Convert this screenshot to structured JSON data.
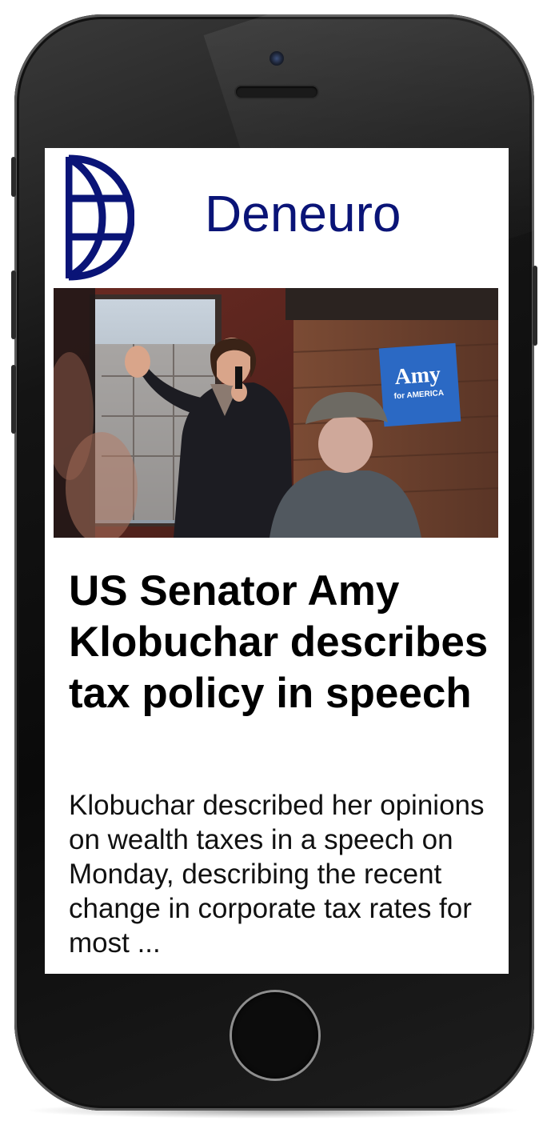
{
  "app": {
    "brand_name": "Deneuro",
    "brand_color": "#0a1477"
  },
  "article": {
    "image_alt": "Amy Klobuchar speaking into a microphone at a campaign event",
    "image_sign_text": "Amy",
    "image_sign_subtext": "for AMERICA",
    "headline": "US Senator Amy Klobuchar describes tax policy in speech",
    "summary": "Klobuchar described her opinions on wealth taxes in a speech on Monday, describing the recent change in corporate tax rates for most ..."
  },
  "icons": {
    "logo": "globe-logo-icon"
  }
}
